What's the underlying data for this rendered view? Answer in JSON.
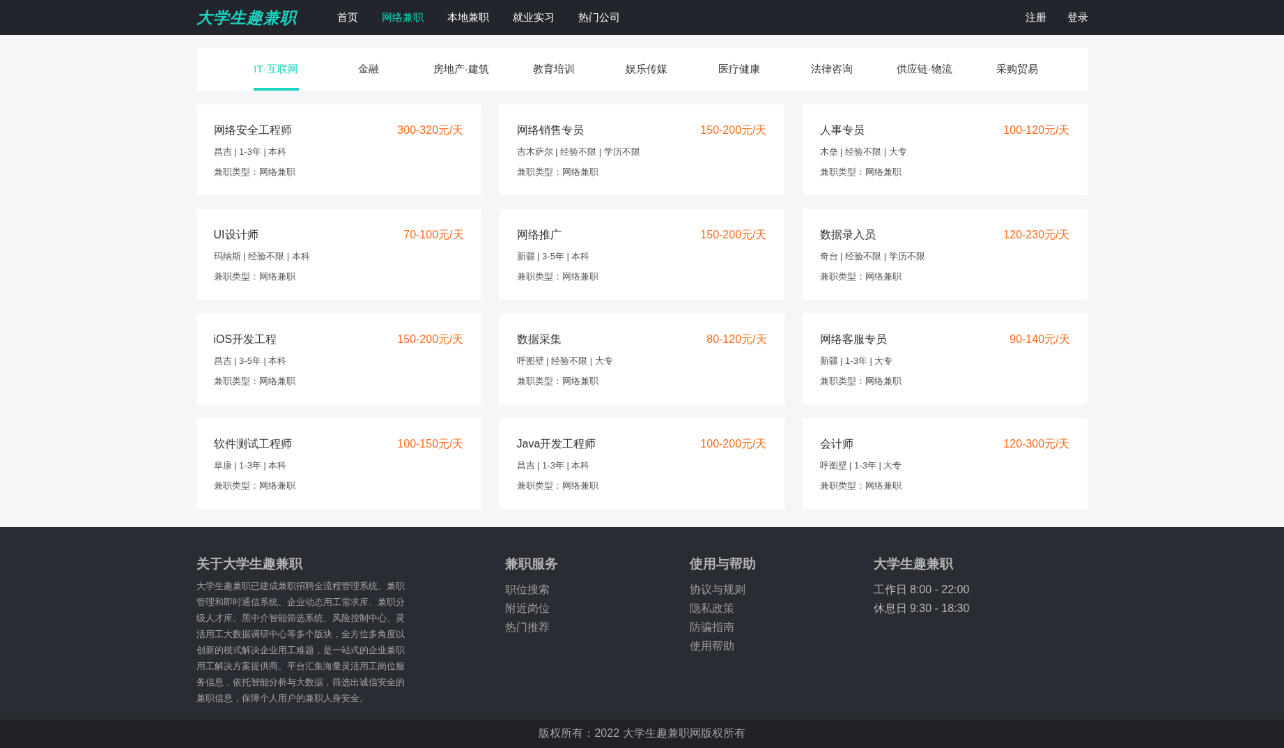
{
  "header": {
    "logo": "大学生趣兼职",
    "nav": [
      {
        "label": "首页",
        "selected": false
      },
      {
        "label": "网络兼职",
        "selected": true
      },
      {
        "label": "本地兼职",
        "selected": false
      },
      {
        "label": "就业实习",
        "selected": false
      },
      {
        "label": "热门公司",
        "selected": false
      }
    ],
    "account_links": [
      "注册",
      "登录"
    ]
  },
  "categories": [
    {
      "label": "IT·互联网",
      "selected": true
    },
    {
      "label": "金融",
      "selected": false
    },
    {
      "label": "房地产·建筑",
      "selected": false
    },
    {
      "label": "教育培训",
      "selected": false
    },
    {
      "label": "娱乐传媒",
      "selected": false
    },
    {
      "label": "医疗健康",
      "selected": false
    },
    {
      "label": "法律咨询",
      "selected": false
    },
    {
      "label": "供应链·物流",
      "selected": false
    },
    {
      "label": "采购贸易",
      "selected": false
    }
  ],
  "jobs": [
    {
      "title": "网络安全工程师",
      "salary": "300-320元/天",
      "details": "昌吉 | 1-3年 | 本科",
      "type": "兼职类型：网络兼职"
    },
    {
      "title": "网络销售专员",
      "salary": "150-200元/天",
      "details": "吉木萨尔 | 经验不限 | 学历不限",
      "type": "兼职类型：网络兼职"
    },
    {
      "title": "人事专员",
      "salary": "100-120元/天",
      "details": "木垒 | 经验不限 | 大专",
      "type": "兼职类型：网络兼职"
    },
    {
      "title": "UI设计师",
      "salary": "70-100元/天",
      "details": "玛纳斯 | 经验不限 | 本科",
      "type": "兼职类型：网络兼职"
    },
    {
      "title": "网络推广",
      "salary": "150-200元/天",
      "details": "新疆 | 3-5年 | 本科",
      "type": "兼职类型：网络兼职"
    },
    {
      "title": "数据录入员",
      "salary": "120-230元/天",
      "details": "奇台 | 经验不限 | 学历不限",
      "type": "兼职类型：网络兼职"
    },
    {
      "title": "iOS开发工程",
      "salary": "150-200元/天",
      "details": "昌吉 | 3-5年 | 本科",
      "type": "兼职类型：网络兼职"
    },
    {
      "title": "数据采集",
      "salary": "80-120元/天",
      "details": "呼图壁 | 经验不限 | 大专",
      "type": "兼职类型：网络兼职"
    },
    {
      "title": "网络客服专员",
      "salary": "90-140元/天",
      "details": "新疆 | 1-3年 | 大专",
      "type": "兼职类型：网络兼职"
    },
    {
      "title": "软件测试工程师",
      "salary": "100-150元/天",
      "details": "阜康 | 1-3年 | 本科",
      "type": "兼职类型：网络兼职"
    },
    {
      "title": "Java开发工程师",
      "salary": "100-200元/天",
      "details": "昌吉 | 1-3年 | 本科",
      "type": "兼职类型：网络兼职"
    },
    {
      "title": "会计师",
      "salary": "120-300元/天",
      "details": "呼图壁 | 1-3年 | 大专",
      "type": "兼职类型：网络兼职"
    }
  ],
  "footer": {
    "about": {
      "heading": "关于大学生趣兼职",
      "text": "大学生趣兼职已建成兼职招聘全流程管理系统、兼职管理和即时通信系统、企业动态用工需求库、兼职分级人才库、黑中介智能筛选系统、风险控制中心、灵活用工大数据调研中心等多个版块，全方位多角度以创新的模式解决企业用工难题，是一站式的企业兼职用工解决方案提供商。平台汇集海量灵活用工岗位服务信息，依托智能分析与大数据，筛选出诚信安全的兼职信息，保障个人用户的兼职人身安全。"
    },
    "columns": [
      {
        "heading": "兼职服务",
        "kind": "links",
        "items": [
          "职位搜索",
          "附近岗位",
          "热门推荐"
        ]
      },
      {
        "heading": "使用与帮助",
        "kind": "links",
        "items": [
          "协议与规则",
          "隐私政策",
          "防骗指南",
          "使用帮助"
        ]
      },
      {
        "heading": "大学生趣兼职",
        "kind": "hours",
        "items": [
          "工作日 8:00 - 22:00",
          "休息日 9:30 - 18:30"
        ]
      }
    ],
    "copyright": "版权所有：2022 大学生趣兼职网版权所有"
  }
}
